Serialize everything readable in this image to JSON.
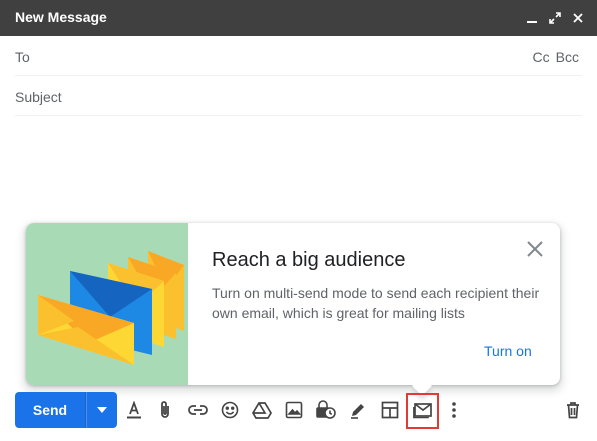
{
  "window": {
    "title": "New Message"
  },
  "fields": {
    "to_label": "To",
    "cc_label": "Cc",
    "bcc_label": "Bcc",
    "subject_placeholder": "Subject"
  },
  "promo": {
    "heading": "Reach a big audience",
    "description": "Turn on multi-send mode to send each recipient their own email, which is great for mailing lists",
    "action": "Turn on"
  },
  "toolbar": {
    "send_label": "Send",
    "tools": [
      "formatting-options",
      "attach-files",
      "insert-link",
      "insert-emoji",
      "insert-drive-file",
      "insert-photo",
      "confidential-mode",
      "insert-signature",
      "layouts",
      "multi-send",
      "more-options"
    ],
    "highlighted_tool": "multi-send"
  },
  "colors": {
    "titlebar": "#404040",
    "accent": "#1a73e8",
    "promo_bg": "#a8dab5",
    "highlight": "#e53935"
  }
}
